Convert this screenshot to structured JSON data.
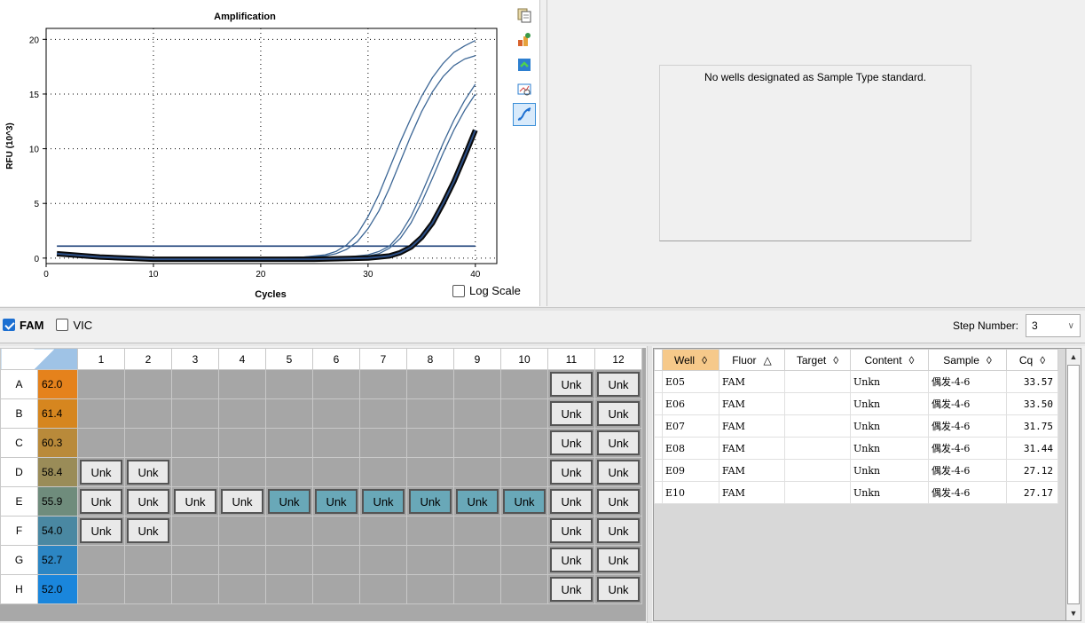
{
  "chart": {
    "title": "Amplification",
    "xlabel": "Cycles",
    "ylabel": "RFU (10^3)",
    "log_scale_label": "Log Scale",
    "log_scale_checked": false
  },
  "chart_data": {
    "type": "line",
    "title": "Amplification",
    "xlabel": "Cycles",
    "ylabel": "RFU (10^3)",
    "xlim": [
      0,
      42
    ],
    "ylim": [
      -0.5,
      21
    ],
    "x_ticks": [
      0,
      10,
      20,
      30,
      40
    ],
    "y_ticks": [
      0,
      5,
      10,
      15,
      20
    ],
    "grid": true,
    "threshold": 1.1,
    "series": [
      {
        "x": [
          1,
          5,
          10,
          15,
          20,
          24,
          26,
          27,
          28,
          29,
          30,
          31,
          32,
          33,
          34,
          35,
          36,
          37,
          38,
          39,
          40
        ],
        "y": [
          0.3,
          0.1,
          0,
          0,
          0,
          0.1,
          0.3,
          0.6,
          1.2,
          2.2,
          3.8,
          5.8,
          8.2,
          10.6,
          12.8,
          14.8,
          16.5,
          17.8,
          18.8,
          19.4,
          19.9
        ]
      },
      {
        "x": [
          1,
          5,
          10,
          15,
          20,
          24,
          26,
          27,
          28,
          29,
          30,
          31,
          32,
          33,
          34,
          35,
          36,
          37,
          38,
          39,
          40
        ],
        "y": [
          0.3,
          0.1,
          0,
          0,
          0,
          0.1,
          0.2,
          0.4,
          0.8,
          1.5,
          2.7,
          4.3,
          6.4,
          8.8,
          11.2,
          13.4,
          15.2,
          16.6,
          17.6,
          18.2,
          18.5
        ]
      },
      {
        "x": [
          1,
          5,
          10,
          15,
          20,
          25,
          28,
          30,
          31,
          32,
          33,
          34,
          35,
          36,
          37,
          38,
          39,
          40
        ],
        "y": [
          0.3,
          0.1,
          0,
          0,
          0,
          0,
          0.1,
          0.3,
          0.6,
          1.1,
          2.2,
          3.8,
          5.9,
          8.2,
          10.5,
          12.6,
          14.4,
          15.9
        ]
      },
      {
        "x": [
          1,
          5,
          10,
          15,
          20,
          25,
          28,
          30,
          31,
          32,
          33,
          34,
          35,
          36,
          37,
          38,
          39,
          40
        ],
        "y": [
          0.3,
          0.1,
          0,
          0,
          0,
          0,
          0.1,
          0.2,
          0.4,
          0.9,
          1.8,
          3.2,
          5.1,
          7.3,
          9.6,
          11.7,
          13.5,
          15.0
        ]
      },
      {
        "x": [
          1,
          5,
          10,
          15,
          20,
          25,
          30,
          31,
          32,
          33,
          34,
          35,
          36,
          37,
          38,
          39,
          40
        ],
        "y": [
          0.4,
          0.1,
          -0.1,
          -0.1,
          -0.1,
          -0.1,
          0,
          0.1,
          0.2,
          0.5,
          1.0,
          1.9,
          3.2,
          5.0,
          7.0,
          9.3,
          11.7
        ],
        "bold": true
      }
    ]
  },
  "toolbar": {
    "icons": [
      "copy-icon",
      "export-icon",
      "refresh-icon",
      "zoom-icon",
      "trace-icon"
    ]
  },
  "standard": {
    "message": "No wells designated as Sample Type standard."
  },
  "fluors": [
    {
      "label": "FAM",
      "checked": true
    },
    {
      "label": "VIC",
      "checked": false
    }
  ],
  "step": {
    "label": "Step Number:",
    "value": "3"
  },
  "plate": {
    "columns": [
      "1",
      "2",
      "3",
      "4",
      "5",
      "6",
      "7",
      "8",
      "9",
      "10",
      "11",
      "12"
    ],
    "rows": [
      {
        "label": "A",
        "temp": "62.0",
        "color": "#e5821c",
        "wells": [
          "",
          "",
          "",
          "",
          "",
          "",
          "",
          "",
          "",
          "",
          "Unk",
          "Unk"
        ],
        "sel": []
      },
      {
        "label": "B",
        "temp": "61.4",
        "color": "#d6861f",
        "wells": [
          "",
          "",
          "",
          "",
          "",
          "",
          "",
          "",
          "",
          "",
          "Unk",
          "Unk"
        ],
        "sel": []
      },
      {
        "label": "C",
        "temp": "60.3",
        "color": "#b98a3a",
        "wells": [
          "",
          "",
          "",
          "",
          "",
          "",
          "",
          "",
          "",
          "",
          "Unk",
          "Unk"
        ],
        "sel": []
      },
      {
        "label": "D",
        "temp": "58.4",
        "color": "#9a8c58",
        "wells": [
          "Unk",
          "Unk",
          "",
          "",
          "",
          "",
          "",
          "",
          "",
          "",
          "Unk",
          "Unk"
        ],
        "sel": []
      },
      {
        "label": "E",
        "temp": "55.9",
        "color": "#6f8c7c",
        "wells": [
          "Unk",
          "Unk",
          "Unk",
          "Unk",
          "Unk",
          "Unk",
          "Unk",
          "Unk",
          "Unk",
          "Unk",
          "Unk",
          "Unk"
        ],
        "sel": [
          4,
          5,
          6,
          7,
          8,
          9
        ]
      },
      {
        "label": "F",
        "temp": "54.0",
        "color": "#4a88a2",
        "wells": [
          "Unk",
          "Unk",
          "",
          "",
          "",
          "",
          "",
          "",
          "",
          "",
          "Unk",
          "Unk"
        ],
        "sel": []
      },
      {
        "label": "G",
        "temp": "52.7",
        "color": "#2c86c4",
        "wells": [
          "",
          "",
          "",
          "",
          "",
          "",
          "",
          "",
          "",
          "",
          "Unk",
          "Unk"
        ],
        "sel": []
      },
      {
        "label": "H",
        "temp": "52.0",
        "color": "#1a86dc",
        "wells": [
          "",
          "",
          "",
          "",
          "",
          "",
          "",
          "",
          "",
          "",
          "Unk",
          "Unk"
        ],
        "sel": []
      }
    ]
  },
  "results": {
    "headers": [
      {
        "label": "Well",
        "sort": "◊",
        "sorted": true
      },
      {
        "label": "Fluor",
        "sort": "△",
        "sorted": false
      },
      {
        "label": "Target",
        "sort": "◊",
        "sorted": false
      },
      {
        "label": "Content",
        "sort": "◊",
        "sorted": false
      },
      {
        "label": "Sample",
        "sort": "◊",
        "sorted": false
      },
      {
        "label": "Cq",
        "sort": "◊",
        "sorted": false
      }
    ],
    "rows": [
      [
        "E05",
        "FAM",
        "",
        "Unkn",
        "偶发-4-6",
        "33.57"
      ],
      [
        "E06",
        "FAM",
        "",
        "Unkn",
        "偶发-4-6",
        "33.50"
      ],
      [
        "E07",
        "FAM",
        "",
        "Unkn",
        "偶发-4-6",
        "31.75"
      ],
      [
        "E08",
        "FAM",
        "",
        "Unkn",
        "偶发-4-6",
        "31.44"
      ],
      [
        "E09",
        "FAM",
        "",
        "Unkn",
        "偶发-4-6",
        "27.12"
      ],
      [
        "E10",
        "FAM",
        "",
        "Unkn",
        "偶发-4-6",
        "27.17"
      ]
    ]
  }
}
